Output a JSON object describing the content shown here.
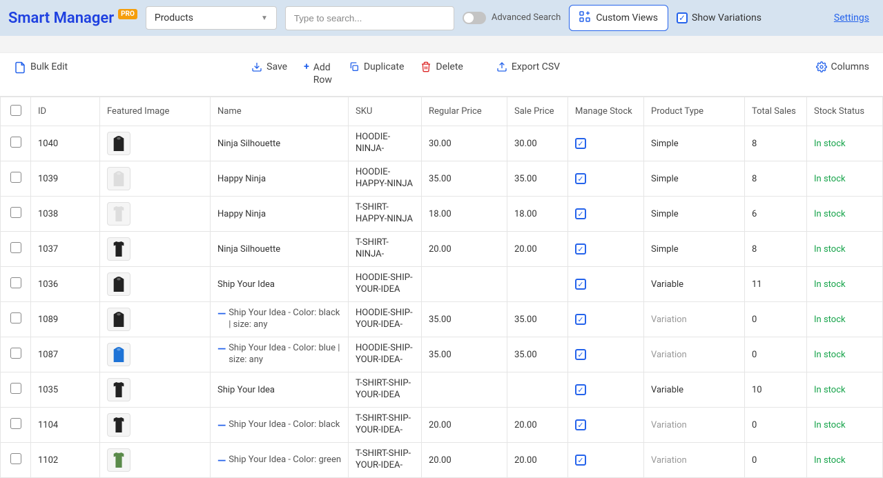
{
  "header": {
    "logo": "Smart Manager",
    "pro": "PRO",
    "dropdown_value": "Products",
    "search_placeholder": "Type to search...",
    "advanced_search": "Advanced Search",
    "custom_views": "Custom Views",
    "show_variations": "Show Variations",
    "settings": "Settings"
  },
  "toolbar": {
    "bulk_edit": "Bulk Edit",
    "save": "Save",
    "add_row_1": "Add",
    "add_row_2": "Row",
    "duplicate": "Duplicate",
    "delete": "Delete",
    "export_csv": "Export CSV",
    "columns": "Columns"
  },
  "columns": {
    "id": "ID",
    "featured_image": "Featured Image",
    "name": "Name",
    "sku": "SKU",
    "regular_price": "Regular Price",
    "sale_price": "Sale Price",
    "manage_stock": "Manage Stock",
    "product_type": "Product Type",
    "total_sales": "Total Sales",
    "stock_status": "Stock Status"
  },
  "rows": [
    {
      "id": "1040",
      "name": "Ninja Silhouette",
      "sku": "HOODIE-NINJA-",
      "regular_price": "30.00",
      "sale_price": "30.00",
      "manage_stock": true,
      "product_type": "Simple",
      "is_variation": false,
      "total_sales": "8",
      "stock_status": "In stock",
      "thumb": "hoodie-black"
    },
    {
      "id": "1039",
      "name": "Happy Ninja",
      "sku": "HOODIE-HAPPY-NINJA",
      "regular_price": "35.00",
      "sale_price": "35.00",
      "manage_stock": true,
      "product_type": "Simple",
      "is_variation": false,
      "total_sales": "8",
      "stock_status": "In stock",
      "thumb": "hoodie-white"
    },
    {
      "id": "1038",
      "name": "Happy Ninja",
      "sku": "T-SHIRT-HAPPY-NINJA",
      "regular_price": "18.00",
      "sale_price": "18.00",
      "manage_stock": true,
      "product_type": "Simple",
      "is_variation": false,
      "total_sales": "6",
      "stock_status": "In stock",
      "thumb": "tshirt-white"
    },
    {
      "id": "1037",
      "name": "Ninja Silhouette",
      "sku": "T-SHIRT-NINJA-",
      "regular_price": "20.00",
      "sale_price": "20.00",
      "manage_stock": true,
      "product_type": "Simple",
      "is_variation": false,
      "total_sales": "8",
      "stock_status": "In stock",
      "thumb": "tshirt-black"
    },
    {
      "id": "1036",
      "name": "Ship Your Idea",
      "sku": "HOODIE-SHIP-YOUR-IDEA",
      "regular_price": "",
      "sale_price": "",
      "manage_stock": true,
      "product_type": "Variable",
      "is_variation": false,
      "total_sales": "11",
      "stock_status": "In stock",
      "thumb": "hoodie-black"
    },
    {
      "id": "1089",
      "name": "Ship Your Idea - Color: black | size: any",
      "sku": "HOODIE-SHIP-YOUR-IDEA-",
      "regular_price": "35.00",
      "sale_price": "35.00",
      "manage_stock": true,
      "product_type": "Variation",
      "is_variation": true,
      "total_sales": "0",
      "stock_status": "In stock",
      "thumb": "hoodie-black"
    },
    {
      "id": "1087",
      "name": "Ship Your Idea - Color: blue | size: any",
      "sku": "HOODIE-SHIP-YOUR-IDEA-",
      "regular_price": "35.00",
      "sale_price": "35.00",
      "manage_stock": true,
      "product_type": "Variation",
      "is_variation": true,
      "total_sales": "0",
      "stock_status": "In stock",
      "thumb": "hoodie-blue"
    },
    {
      "id": "1035",
      "name": "Ship Your Idea",
      "sku": "T-SHIRT-SHIP-YOUR-IDEA",
      "regular_price": "",
      "sale_price": "",
      "manage_stock": true,
      "product_type": "Variable",
      "is_variation": false,
      "total_sales": "10",
      "stock_status": "In stock",
      "thumb": "tshirt-black"
    },
    {
      "id": "1104",
      "name": "Ship Your Idea - Color: black",
      "sku": "T-SHIRT-SHIP-YOUR-IDEA-",
      "regular_price": "20.00",
      "sale_price": "20.00",
      "manage_stock": true,
      "product_type": "Variation",
      "is_variation": true,
      "total_sales": "0",
      "stock_status": "In stock",
      "thumb": "tshirt-black"
    },
    {
      "id": "1102",
      "name": "Ship Your Idea - Color: green",
      "sku": "T-SHIRT-SHIP-YOUR-IDEA-",
      "regular_price": "20.00",
      "sale_price": "20.00",
      "manage_stock": true,
      "product_type": "Variation",
      "is_variation": true,
      "total_sales": "0",
      "stock_status": "In stock",
      "thumb": "tshirt-green"
    }
  ]
}
